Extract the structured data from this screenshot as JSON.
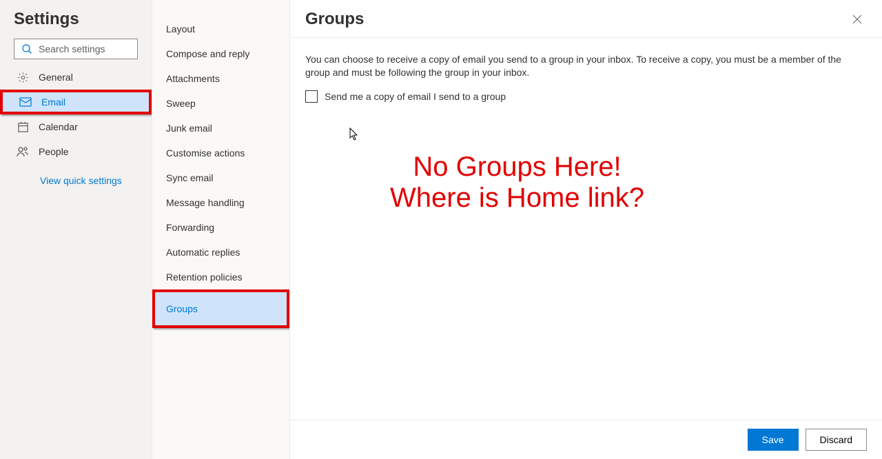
{
  "title": "Settings",
  "search": {
    "placeholder": "Search settings"
  },
  "nav": {
    "items": [
      {
        "label": "General"
      },
      {
        "label": "Email"
      },
      {
        "label": "Calendar"
      },
      {
        "label": "People"
      }
    ],
    "quick": "View quick settings"
  },
  "subnav": {
    "items": [
      {
        "label": "Layout"
      },
      {
        "label": "Compose and reply"
      },
      {
        "label": "Attachments"
      },
      {
        "label": "Sweep"
      },
      {
        "label": "Junk email"
      },
      {
        "label": "Customise actions"
      },
      {
        "label": "Sync email"
      },
      {
        "label": "Message handling"
      },
      {
        "label": "Forwarding"
      },
      {
        "label": "Automatic replies"
      },
      {
        "label": "Retention policies"
      },
      {
        "label": "Groups"
      }
    ]
  },
  "detail": {
    "heading": "Groups",
    "description": "You can choose to receive a copy of email you send to a group in your inbox. To receive a copy, you must be a member of the group and must be following the group in your inbox.",
    "checkbox_label": "Send me a copy of email I send to a group"
  },
  "annotation": {
    "line1": "No Groups Here!",
    "line2": "Where is Home link?"
  },
  "footer": {
    "save": "Save",
    "discard": "Discard"
  }
}
